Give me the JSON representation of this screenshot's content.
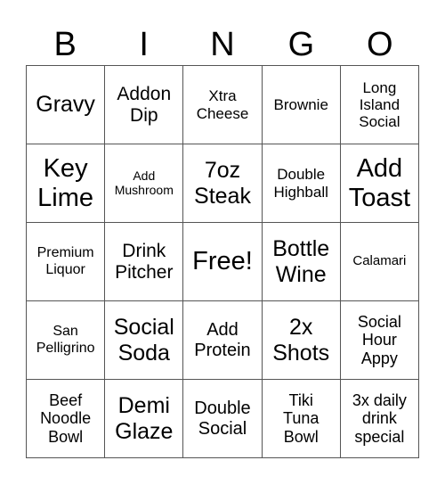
{
  "header": {
    "letters": [
      "B",
      "I",
      "N",
      "G",
      "O"
    ]
  },
  "card": {
    "rows": [
      [
        "Gravy",
        "Addon\nDip",
        "Xtra\nCheese",
        "Brownie",
        "Long\nIsland\nSocial"
      ],
      [
        "Key\nLime",
        "Add\nMushroom",
        "7oz\nSteak",
        "Double\nHighball",
        "Add\nToast"
      ],
      [
        "Premium\nLiquor",
        "Drink\nPitcher",
        "Free!",
        "Bottle\nWine",
        "Calamari"
      ],
      [
        "San\nPelligrino",
        "Social\nSoda",
        "Add\nProtein",
        "2x\nShots",
        "Social\nHour\nAppy"
      ],
      [
        "Beef\nNoodle\nBowl",
        "Demi\nGlaze",
        "Double\nSocial",
        "Tiki\nTuna\nBowl",
        "3x daily\ndrink\nspecial"
      ]
    ]
  }
}
